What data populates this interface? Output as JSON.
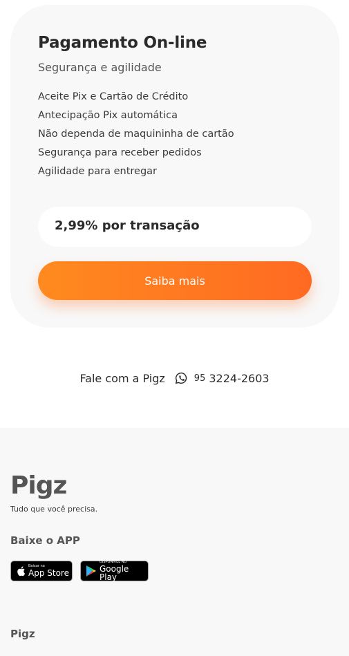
{
  "card": {
    "title": "Pagamento On-line",
    "subtitle": "Segurança e agilidade",
    "features": [
      "Aceite Pix e Cartão de Crédito",
      "Antecipação Pix automática",
      "Não dependa de maquininha de cartão",
      "Segurança para receber pedidos",
      "Agilidade para entregar"
    ],
    "price": "2,99% por transação",
    "cta_label": "Saiba mais"
  },
  "contact": {
    "label": "Fale com a Pigz",
    "icon": "whatsapp-icon",
    "area_code": "95",
    "number": "3224-2603"
  },
  "footer": {
    "logo_text": "Pigz",
    "tagline": "Tudo que você precisa.",
    "app_heading": "Baixe o APP",
    "app_store": {
      "small": "Baixar na",
      "big": "App Store",
      "icon": "apple-icon"
    },
    "google_play": {
      "small": "DISPONÍVEL NO",
      "big": "Google Play",
      "icon": "google-play-icon"
    },
    "link_pigz": "Pigz"
  },
  "colors": {
    "accent_start": "#ff8a1f",
    "accent_end": "#ff6a22",
    "card_bg": "#f8f8f8",
    "text_dark": "#2b2b2b"
  }
}
